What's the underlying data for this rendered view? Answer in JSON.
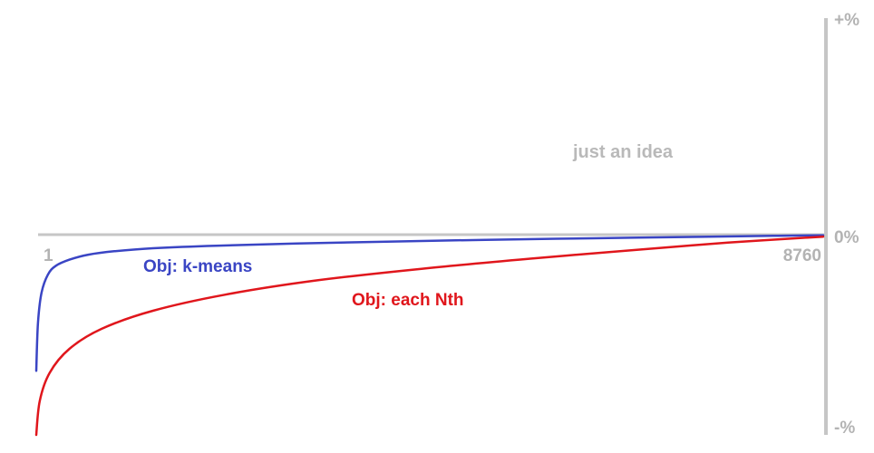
{
  "chart_data": {
    "type": "line",
    "x_range": [
      1,
      8760
    ],
    "x_tick_labels": [
      "1",
      "8760"
    ],
    "y_tick_labels": {
      "top": "+%",
      "zero": "0%",
      "bottom": "-%"
    },
    "annotation": "just an idea",
    "grid": false,
    "series": [
      {
        "name": "Obj: k-means",
        "color": "#3a45c4",
        "x": [
          1,
          20,
          60,
          130,
          220,
          370,
          580,
          870,
          1300,
          2000,
          2900,
          3900,
          5000,
          6200,
          7400,
          8200,
          8760
        ],
        "y": [
          -0.68,
          -0.44,
          -0.29,
          -0.2,
          -0.155,
          -0.125,
          -0.1,
          -0.083,
          -0.068,
          -0.055,
          -0.044,
          -0.035,
          -0.026,
          -0.018,
          -0.011,
          -0.006,
          -0.003
        ]
      },
      {
        "name": "Obj: each Nth",
        "color": "#e0161c",
        "x": [
          1,
          40,
          150,
          370,
          730,
          1300,
          2100,
          3100,
          4300,
          5500,
          6700,
          7700,
          8760
        ],
        "y": [
          -1.0,
          -0.83,
          -0.69,
          -0.57,
          -0.47,
          -0.38,
          -0.3,
          -0.23,
          -0.17,
          -0.12,
          -0.075,
          -0.04,
          -0.01
        ]
      }
    ]
  }
}
